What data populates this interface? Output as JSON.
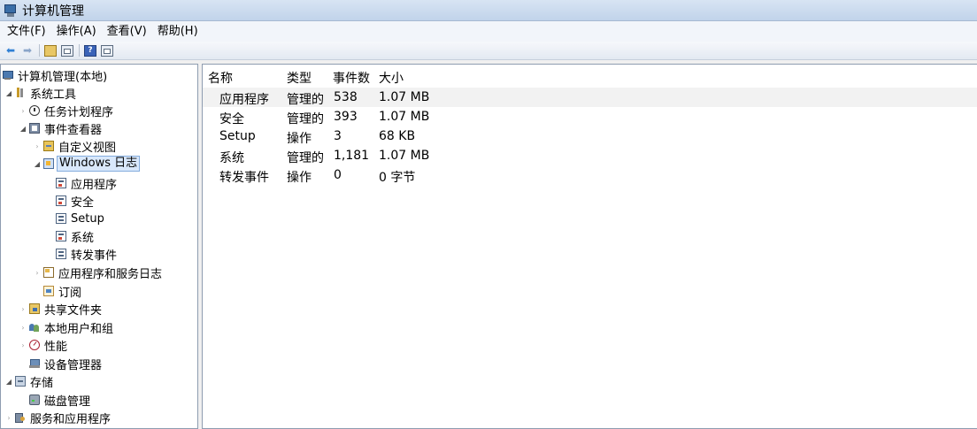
{
  "window": {
    "title": "计算机管理"
  },
  "menu": [
    {
      "label": "文件(F)"
    },
    {
      "label": "操作(A)"
    },
    {
      "label": "查看(V)"
    },
    {
      "label": "帮助(H)"
    }
  ],
  "toolbar": {
    "icons": [
      "back-arrow-icon",
      "forward-arrow-icon",
      "up-folder-icon",
      "show-hide-tree-icon",
      "help-icon",
      "properties-icon"
    ]
  },
  "tree": [
    {
      "label": "计算机管理(本地)",
      "icon": "computer-icon",
      "level": 0,
      "expander": "none"
    },
    {
      "label": "系统工具",
      "icon": "system-tools-icon",
      "level": 0,
      "expander": "open"
    },
    {
      "label": "任务计划程序",
      "icon": "task-scheduler-icon",
      "level": 1,
      "expander": "closed"
    },
    {
      "label": "事件查看器",
      "icon": "event-viewer-icon",
      "level": 1,
      "expander": "open"
    },
    {
      "label": "自定义视图",
      "icon": "custom-views-icon",
      "level": 2,
      "expander": "closed"
    },
    {
      "label": "Windows 日志",
      "icon": "windows-logs-icon",
      "level": 2,
      "expander": "open",
      "selected": true
    },
    {
      "label": "应用程序",
      "icon": "log-icon",
      "level": 3,
      "expander": "none"
    },
    {
      "label": "安全",
      "icon": "log-icon",
      "level": 3,
      "expander": "none"
    },
    {
      "label": "Setup",
      "icon": "log-icon",
      "level": 3,
      "expander": "none"
    },
    {
      "label": "系统",
      "icon": "log-icon",
      "level": 3,
      "expander": "none"
    },
    {
      "label": "转发事件",
      "icon": "log-icon",
      "level": 3,
      "expander": "none"
    },
    {
      "label": "应用程序和服务日志",
      "icon": "app-service-logs-icon",
      "level": 2,
      "expander": "closed"
    },
    {
      "label": "订阅",
      "icon": "subscriptions-icon",
      "level": 2,
      "expander": "none"
    },
    {
      "label": "共享文件夹",
      "icon": "shared-folders-icon",
      "level": 1,
      "expander": "closed"
    },
    {
      "label": "本地用户和组",
      "icon": "local-users-icon",
      "level": 1,
      "expander": "closed"
    },
    {
      "label": "性能",
      "icon": "performance-icon",
      "level": 1,
      "expander": "closed"
    },
    {
      "label": "设备管理器",
      "icon": "device-manager-icon",
      "level": 1,
      "expander": "none"
    },
    {
      "label": "存储",
      "icon": "storage-icon",
      "level": 0,
      "expander": "open"
    },
    {
      "label": "磁盘管理",
      "icon": "disk-management-icon",
      "level": 1,
      "expander": "none"
    },
    {
      "label": "服务和应用程序",
      "icon": "services-apps-icon",
      "level": 0,
      "expander": "closed"
    }
  ],
  "list": {
    "columns": [
      "名称",
      "类型",
      "事件数",
      "大小"
    ],
    "rows": [
      [
        "应用程序",
        "管理的",
        "538",
        "1.07 MB"
      ],
      [
        "安全",
        "管理的",
        "393",
        "1.07 MB"
      ],
      [
        "Setup",
        "操作",
        "3",
        "68 KB"
      ],
      [
        "系统",
        "管理的",
        "1,181",
        "1.07 MB"
      ],
      [
        "转发事件",
        "操作",
        "0",
        "0 字节"
      ]
    ]
  }
}
